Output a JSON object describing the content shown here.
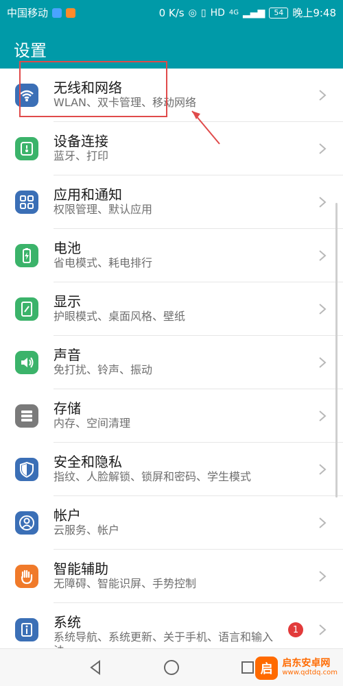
{
  "status_bar": {
    "carrier": "中国移动",
    "net_speed": "0 K/s",
    "signal_label": "4G",
    "battery_level": "54",
    "time": "晚上9:48"
  },
  "header": {
    "title": "设置"
  },
  "settings": {
    "items": [
      {
        "title": "无线和网络",
        "subtitle": "WLAN、双卡管理、移动网络",
        "icon": "wifi-icon",
        "color": "#3b6fb6"
      },
      {
        "title": "设备连接",
        "subtitle": "蓝牙、打印",
        "icon": "device-connection-icon",
        "color": "#3bb36a"
      },
      {
        "title": "应用和通知",
        "subtitle": "权限管理、默认应用",
        "icon": "apps-grid-icon",
        "color": "#3b6fb6"
      },
      {
        "title": "电池",
        "subtitle": "省电模式、耗电排行",
        "icon": "battery-icon",
        "color": "#3bb36a"
      },
      {
        "title": "显示",
        "subtitle": "护眼模式、桌面风格、壁纸",
        "icon": "display-icon",
        "color": "#3bb36a"
      },
      {
        "title": "声音",
        "subtitle": "免打扰、铃声、振动",
        "icon": "speaker-icon",
        "color": "#3bb36a"
      },
      {
        "title": "存储",
        "subtitle": "内存、空间清理",
        "icon": "storage-icon",
        "color": "#7a7a7a"
      },
      {
        "title": "安全和隐私",
        "subtitle": "指纹、人脸解锁、锁屏和密码、学生模式",
        "icon": "shield-icon",
        "color": "#3b6fb6"
      },
      {
        "title": "帐户",
        "subtitle": "云服务、帐户",
        "icon": "account-icon",
        "color": "#3b6fb6"
      },
      {
        "title": "智能辅助",
        "subtitle": "无障碍、智能识屏、手势控制",
        "icon": "hand-icon",
        "color": "#f07a2a"
      },
      {
        "title": "系统",
        "subtitle": "系统导航、系统更新、关于手机、语言和输入法",
        "icon": "system-info-icon",
        "color": "#3b6fb6",
        "badge": "1"
      }
    ]
  },
  "watermark": {
    "name": "启东安卓网",
    "url": "www.qdtdq.com",
    "logo_letter": "启"
  }
}
